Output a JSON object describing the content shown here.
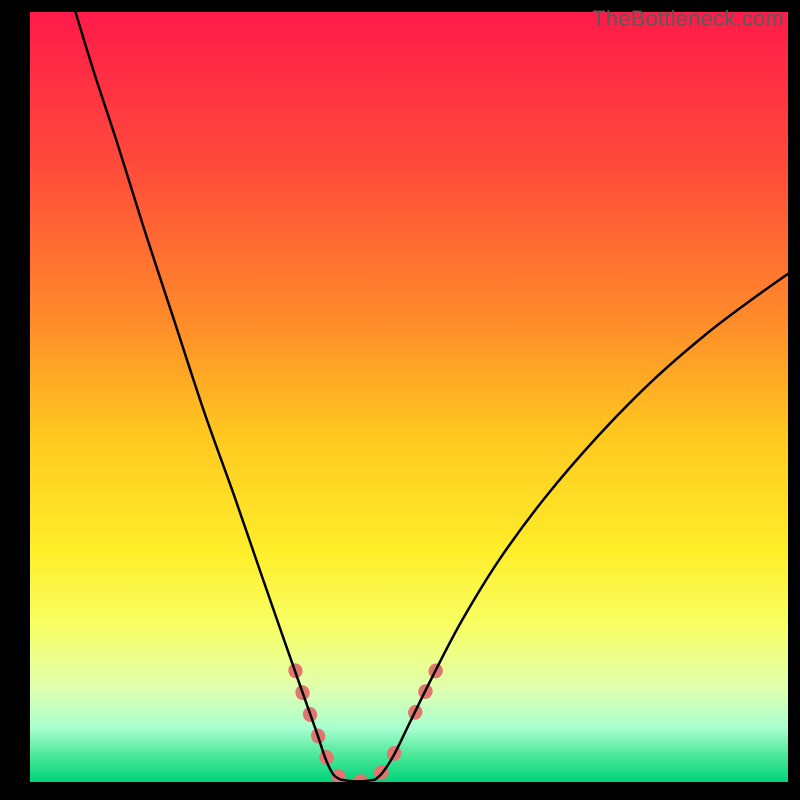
{
  "watermark": "TheBottleneck.com",
  "chart_data": {
    "type": "line",
    "title": "",
    "xlabel": "",
    "ylabel": "",
    "xlim": [
      0,
      100
    ],
    "ylim": [
      0,
      100
    ],
    "gradient_stops": [
      {
        "offset": 0.0,
        "color": "#ff1b4a"
      },
      {
        "offset": 0.2,
        "color": "#ff4b3a"
      },
      {
        "offset": 0.4,
        "color": "#ff8b2a"
      },
      {
        "offset": 0.55,
        "color": "#ffc81f"
      },
      {
        "offset": 0.7,
        "color": "#ffee2a"
      },
      {
        "offset": 0.8,
        "color": "#f7ff66"
      },
      {
        "offset": 0.88,
        "color": "#dfffb0"
      },
      {
        "offset": 0.93,
        "color": "#a8ffd0"
      },
      {
        "offset": 0.965,
        "color": "#4de89a"
      },
      {
        "offset": 1.0,
        "color": "#00d37a"
      }
    ],
    "series": [
      {
        "name": "left-branch",
        "stroke": "#000000",
        "stroke_width": 2.5,
        "points": [
          {
            "x": 6.0,
            "y": 100.0
          },
          {
            "x": 8.5,
            "y": 92.0
          },
          {
            "x": 11.5,
            "y": 83.0
          },
          {
            "x": 15.0,
            "y": 72.0
          },
          {
            "x": 19.0,
            "y": 60.0
          },
          {
            "x": 23.0,
            "y": 48.0
          },
          {
            "x": 27.0,
            "y": 37.0
          },
          {
            "x": 30.5,
            "y": 27.0
          },
          {
            "x": 33.5,
            "y": 18.5
          },
          {
            "x": 36.0,
            "y": 11.5
          },
          {
            "x": 37.8,
            "y": 6.5
          },
          {
            "x": 39.0,
            "y": 3.0
          },
          {
            "x": 40.0,
            "y": 1.0
          },
          {
            "x": 41.0,
            "y": 0.3
          }
        ]
      },
      {
        "name": "valley-floor",
        "stroke": "#000000",
        "stroke_width": 2.5,
        "points": [
          {
            "x": 41.0,
            "y": 0.3
          },
          {
            "x": 42.5,
            "y": 0.1
          },
          {
            "x": 44.0,
            "y": 0.1
          },
          {
            "x": 45.5,
            "y": 0.3
          }
        ]
      },
      {
        "name": "right-branch",
        "stroke": "#000000",
        "stroke_width": 2.5,
        "points": [
          {
            "x": 45.5,
            "y": 0.3
          },
          {
            "x": 46.5,
            "y": 1.2
          },
          {
            "x": 48.0,
            "y": 3.5
          },
          {
            "x": 50.0,
            "y": 7.5
          },
          {
            "x": 53.0,
            "y": 13.5
          },
          {
            "x": 57.0,
            "y": 21.0
          },
          {
            "x": 62.0,
            "y": 29.0
          },
          {
            "x": 68.0,
            "y": 37.0
          },
          {
            "x": 75.0,
            "y": 45.0
          },
          {
            "x": 82.0,
            "y": 52.0
          },
          {
            "x": 89.0,
            "y": 58.0
          },
          {
            "x": 95.0,
            "y": 62.5
          },
          {
            "x": 100.0,
            "y": 66.0
          }
        ]
      }
    ],
    "marker_segments": [
      {
        "name": "left-marker",
        "stroke": "#e0766f",
        "stroke_width": 14,
        "points": [
          {
            "x": 35.0,
            "y": 14.5
          },
          {
            "x": 36.5,
            "y": 10.0
          },
          {
            "x": 38.0,
            "y": 6.0
          },
          {
            "x": 39.2,
            "y": 3.0
          },
          {
            "x": 40.2,
            "y": 1.2
          },
          {
            "x": 41.5,
            "y": 0.3
          },
          {
            "x": 43.0,
            "y": 0.1
          },
          {
            "x": 44.5,
            "y": 0.2
          },
          {
            "x": 45.8,
            "y": 0.8
          },
          {
            "x": 47.0,
            "y": 2.0
          },
          {
            "x": 48.2,
            "y": 4.0
          },
          {
            "x": 49.2,
            "y": 6.0
          }
        ]
      },
      {
        "name": "right-marker",
        "stroke": "#e0766f",
        "stroke_width": 14,
        "points": [
          {
            "x": 50.8,
            "y": 9.0
          },
          {
            "x": 52.3,
            "y": 12.0
          },
          {
            "x": 53.8,
            "y": 15.0
          }
        ]
      }
    ]
  }
}
